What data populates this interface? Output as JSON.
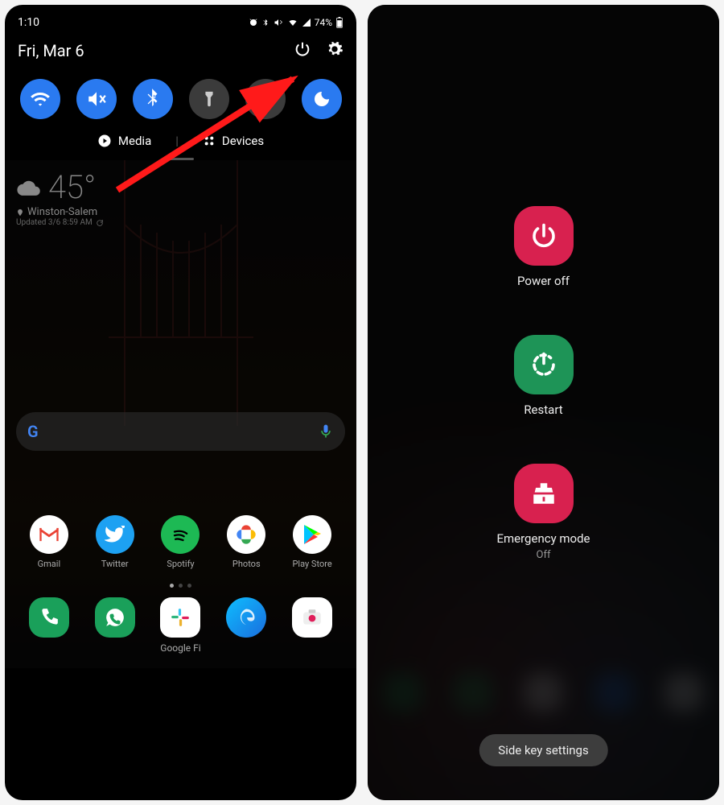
{
  "left": {
    "status": {
      "time": "1:10",
      "battery": "74%"
    },
    "date": "Fri, Mar 6",
    "qs": {
      "wifi": "wifi-icon",
      "mute": "mute-vibrate-icon",
      "bluetooth": "bluetooth-icon",
      "flashlight": "flashlight-icon",
      "powersave": "power-save-icon",
      "dnd": "dnd-moon-icon"
    },
    "media_label": "Media",
    "devices_label": "Devices",
    "weather": {
      "temp": "45°",
      "location": "Winston-Salem",
      "updated": "Updated 3/6 8:59 AM"
    },
    "apps": [
      {
        "name": "Gmail"
      },
      {
        "name": "Twitter"
      },
      {
        "name": "Spotify"
      },
      {
        "name": "Photos"
      },
      {
        "name": "Play Store"
      }
    ],
    "dock_label": "Google Fi",
    "search_logo": "G"
  },
  "right": {
    "power_off": "Power off",
    "restart": "Restart",
    "emergency": "Emergency mode",
    "emergency_state": "Off",
    "side_key": "Side key settings"
  }
}
